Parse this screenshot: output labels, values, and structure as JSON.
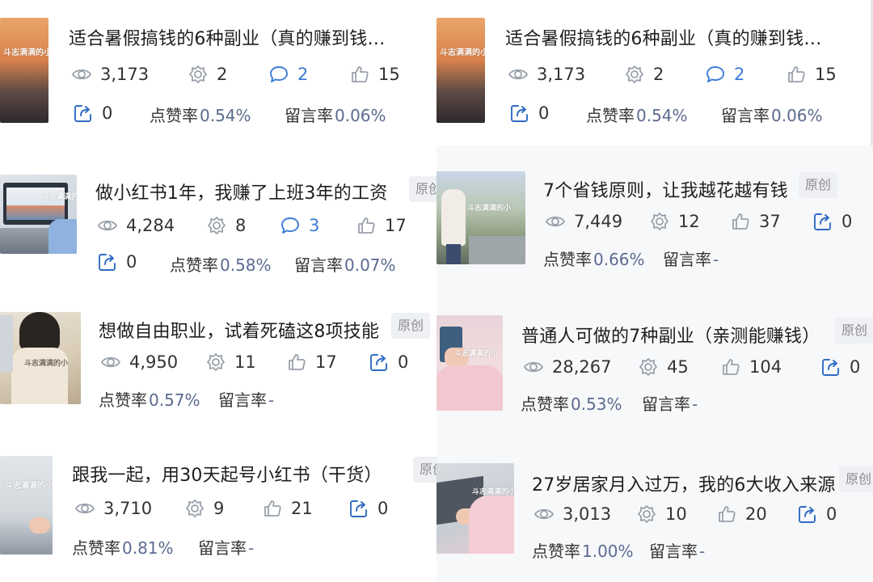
{
  "watermark": "斗志满满的小",
  "colors": {
    "link_blue": "#3b7bd6",
    "rate_value": "#5b6b8f",
    "badge_bg": "#eef0f3"
  },
  "labels": {
    "like_rate": "点赞率",
    "comment_rate": "留言率"
  },
  "cards": [
    {
      "title": "适合暑假搞钱的6种副业（真的赚到钱…",
      "badge": "",
      "views": "3,173",
      "shares": "2",
      "comments": "2",
      "likes": "15",
      "forwards": "0",
      "like_rate": "0.54%",
      "comment_rate": "0.06%"
    },
    {
      "title": "适合暑假搞钱的6种副业（真的赚到钱…",
      "badge": "",
      "views": "3,173",
      "shares": "2",
      "comments": "2",
      "likes": "15",
      "forwards": "0",
      "like_rate": "0.54%",
      "comment_rate": "0.06%"
    },
    {
      "title": "做小红书1年，我赚了上班3年的工资",
      "badge": "原创",
      "views": "4,284",
      "shares": "8",
      "comments": "3",
      "likes": "17",
      "forwards": "0",
      "like_rate": "0.58%",
      "comment_rate": "0.07%"
    },
    {
      "title": "7个省钱原则，让我越花越有钱",
      "badge": "原创",
      "views": "7,449",
      "shares": "12",
      "likes": "37",
      "forwards": "0",
      "like_rate": "0.66%",
      "comment_rate": "-"
    },
    {
      "title": "想做自由职业，试着死磕这8项技能",
      "badge": "原创",
      "views": "4,950",
      "shares": "11",
      "likes": "17",
      "forwards": "0",
      "like_rate": "0.57%",
      "comment_rate": "-"
    },
    {
      "title": "普通人可做的7种副业（亲测能赚钱）",
      "badge": "原创",
      "views": "28,267",
      "shares": "45",
      "likes": "104",
      "forwards": "0",
      "like_rate": "0.53%",
      "comment_rate": "-"
    },
    {
      "title": "跟我一起，用30天起号小红书（干货）",
      "badge": "原创",
      "views": "3,710",
      "shares": "9",
      "likes": "21",
      "forwards": "0",
      "like_rate": "0.81%",
      "comment_rate": "-"
    },
    {
      "title": "27岁居家月入过万，我的6大收入来源",
      "badge": "原创",
      "views": "3,013",
      "shares": "10",
      "likes": "20",
      "forwards": "0",
      "like_rate": "1.00%",
      "comment_rate": "-"
    }
  ]
}
